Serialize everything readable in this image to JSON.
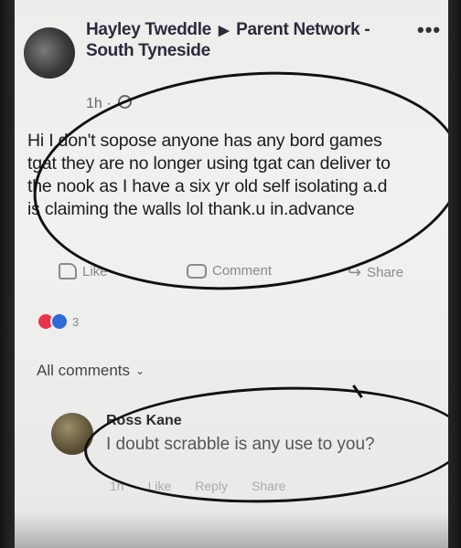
{
  "post": {
    "author": "Hayley Tweddle",
    "group": "Parent Network - South Tyneside",
    "time": "1h",
    "more": "•••",
    "text_line1": "Hi I don't sopose anyone has any bord games",
    "text_line2": "tgat they are no longer using tgat can deliver to",
    "text_line3": "the nook as I have a six yr old self isolating a.d",
    "text_line4": "is claiming the walls lol  thank.u in.advance"
  },
  "actions": {
    "like": "Like",
    "comment": "Comment",
    "share": "Share"
  },
  "reactions": {
    "count": "3"
  },
  "comments_filter": "All comments",
  "comment": {
    "name": "Ross Kane",
    "text": "I doubt scrabble is any use to you?",
    "time": "1h",
    "like": "Like",
    "reply": "Reply",
    "share": "Share"
  }
}
